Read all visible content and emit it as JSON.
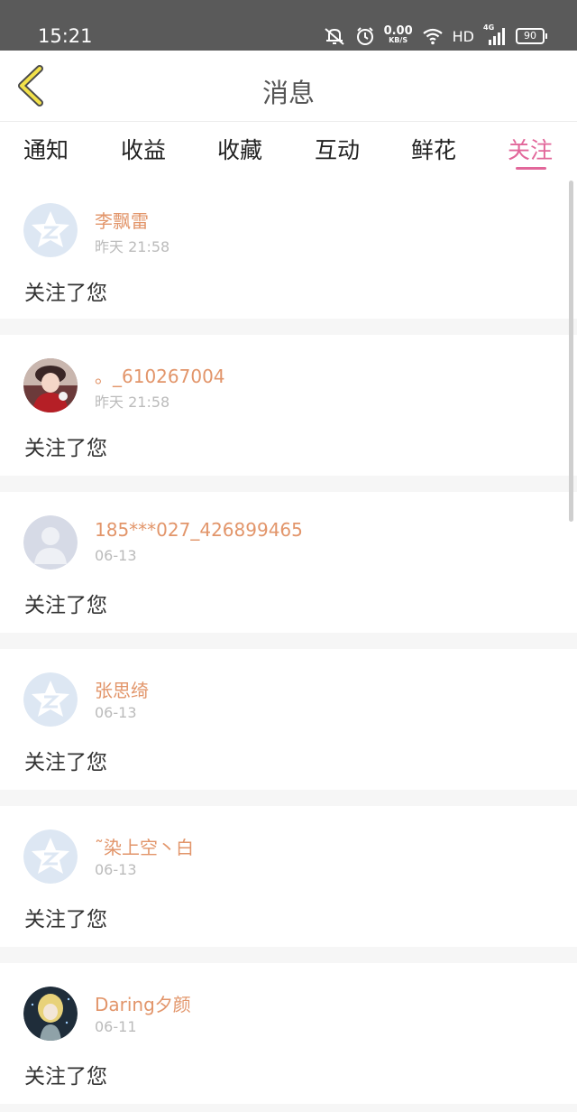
{
  "status_bar": {
    "time": "15:21",
    "net_speed_value": "0.00",
    "net_speed_unit": "KB/S",
    "hd_label": "HD",
    "signal_label": "4G",
    "battery": "90",
    "icons": [
      "mute-icon",
      "alarm-icon",
      "wifi-icon",
      "signal-icon",
      "battery-icon"
    ]
  },
  "header": {
    "title": "消息",
    "back_icon": "chevron-left-icon"
  },
  "tabs": [
    {
      "label": "通知",
      "active": false
    },
    {
      "label": "收益",
      "active": false
    },
    {
      "label": "收藏",
      "active": false
    },
    {
      "label": "互动",
      "active": false
    },
    {
      "label": "鲜花",
      "active": false
    },
    {
      "label": "关注",
      "active": true
    }
  ],
  "colors": {
    "accent": "#e2679a",
    "name": "#e2956a",
    "time": "#bbbbbb",
    "message": "#333333"
  },
  "messages": [
    {
      "name": "李飘雷",
      "time": "昨天 21:58",
      "text": "关注了您",
      "avatar": "default-star-avatar"
    },
    {
      "name": "。_610267004",
      "time": "昨天 21:58",
      "text": "关注了您",
      "avatar": "photo-avatar-girl-red"
    },
    {
      "name": "185***027_426899465",
      "time": "06-13",
      "text": "关注了您",
      "avatar": "default-person-avatar"
    },
    {
      "name": "张思绮",
      "time": "06-13",
      "text": "关注了您",
      "avatar": "default-star-avatar"
    },
    {
      "name": "˜染上空丶白",
      "time": "06-13",
      "text": "关注了您",
      "avatar": "default-star-avatar"
    },
    {
      "name": "Daring夕颜",
      "time": "06-11",
      "text": "关注了您",
      "avatar": "photo-avatar-anime-girl"
    }
  ]
}
